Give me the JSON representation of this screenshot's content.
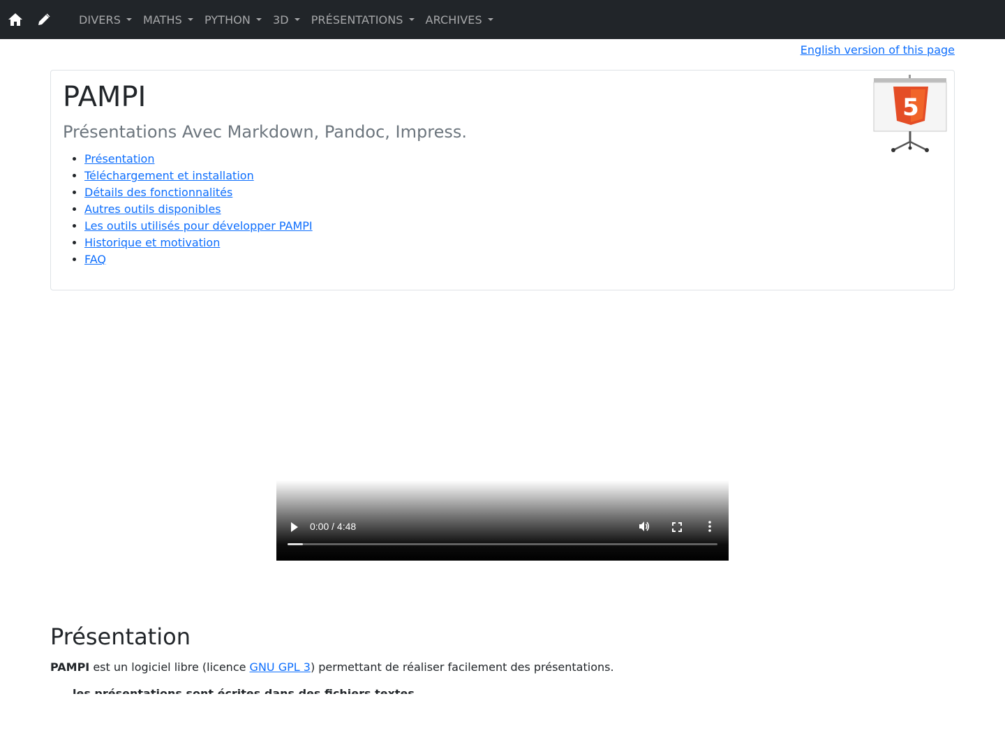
{
  "navbar": {
    "menu": [
      {
        "label": "DIVERS"
      },
      {
        "label": "MATHS"
      },
      {
        "label": "PYTHON"
      },
      {
        "label": "3D"
      },
      {
        "label": "PRÉSENTATIONS"
      },
      {
        "label": "ARCHIVES"
      }
    ],
    "icons": [
      "home-icon",
      "pencil-icon"
    ]
  },
  "lang_link": "English version of this page",
  "card": {
    "title": "PAMPI",
    "subtitle": "Présentations Avec Markdown, Pandoc, Impress.",
    "toc": [
      {
        "label": "Présentation"
      },
      {
        "label": "Téléchargement et installation"
      },
      {
        "label": "Détails des fonctionnalités"
      },
      {
        "label": "Autres outils disponibles"
      },
      {
        "label": "Les outils utilisés pour développer PAMPI"
      },
      {
        "label": "Historique et motivation"
      },
      {
        "label": "FAQ"
      }
    ],
    "logo_text": "5"
  },
  "video": {
    "time": "0:00 / 4:48",
    "progress": 0.035
  },
  "section": {
    "title": "Présentation",
    "para_bold": "PAMPI",
    "para_text1": " est un logiciel libre (licence ",
    "para_link": "GNU GPL 3",
    "para_text2": ") permettant de réaliser facilement des présentations.",
    "clipped_line": "les présentations sont écrites dans des fichiers textes"
  },
  "colors": {
    "navbar_bg": "#212529",
    "link": "#0d6efd",
    "html5_orange": "#e44d26"
  }
}
